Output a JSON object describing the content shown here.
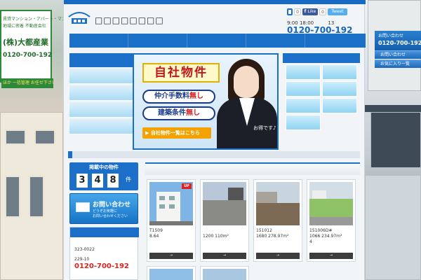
{
  "site": {
    "logo_name": "□□□□□□□□",
    "logo_tag": "おいしい住まい マンション"
  },
  "social": {
    "like_label": "Like",
    "like_count": "0",
    "tweet_label": "Tweet",
    "share_count": "0"
  },
  "header": {
    "hours": "9:00 18:00",
    "holiday": "13",
    "phone": "0120-700-192"
  },
  "left_sign": {
    "tag1": "賃貸マンション・アパート・マンション",
    "tag2": "地域に密着 不動産会社",
    "company": "(株)大都産業",
    "phone": "0120-700-192",
    "strip": "ほか 一括管理 お任せ下さい"
  },
  "hero": {
    "title": "自社物件",
    "pill1_prefix": "仲介手数料",
    "pill1_strong": "無し",
    "pill2_prefix": "建築条件",
    "pill2_strong": "無し",
    "button": "▶ 自社物件一覧はこちら",
    "bubble": "お得です♪"
  },
  "count": {
    "label": "掲載中の物件",
    "digits": [
      "3",
      "4",
      "8"
    ],
    "unit": "件"
  },
  "inquiry": {
    "title": "お問い合わせ",
    "sub1": "どうぞお気軽に",
    "sub2": "お問い合わせください"
  },
  "company_info": {
    "zip": "323-0022",
    "addr": "229-10",
    "phone": "0120-700-192"
  },
  "listings": [
    {
      "line1": "T1509",
      "line2": "8.64",
      "line3": "",
      "badge": "UP",
      "button": "→"
    },
    {
      "line1": "",
      "line2": "1200  110m²",
      "line3": "",
      "badge": "",
      "button": "→"
    },
    {
      "line1": "151012",
      "line2": "1680  278.97m²",
      "line3": "",
      "badge": "",
      "button": "→"
    },
    {
      "line1": "151006D#",
      "line2": "1066  234.97m²",
      "line3": "4",
      "badge": "",
      "button": "→"
    }
  ],
  "right_widget": {
    "inquiry_label": "お問い合わせ",
    "phone": "0120-700-192",
    "btn1": "お問い合わせ",
    "btn2": "お気に入り一覧"
  },
  "colors": {
    "primary": "#1a6fc7",
    "accent_red": "#d8261e",
    "orange": "#f3a200"
  }
}
